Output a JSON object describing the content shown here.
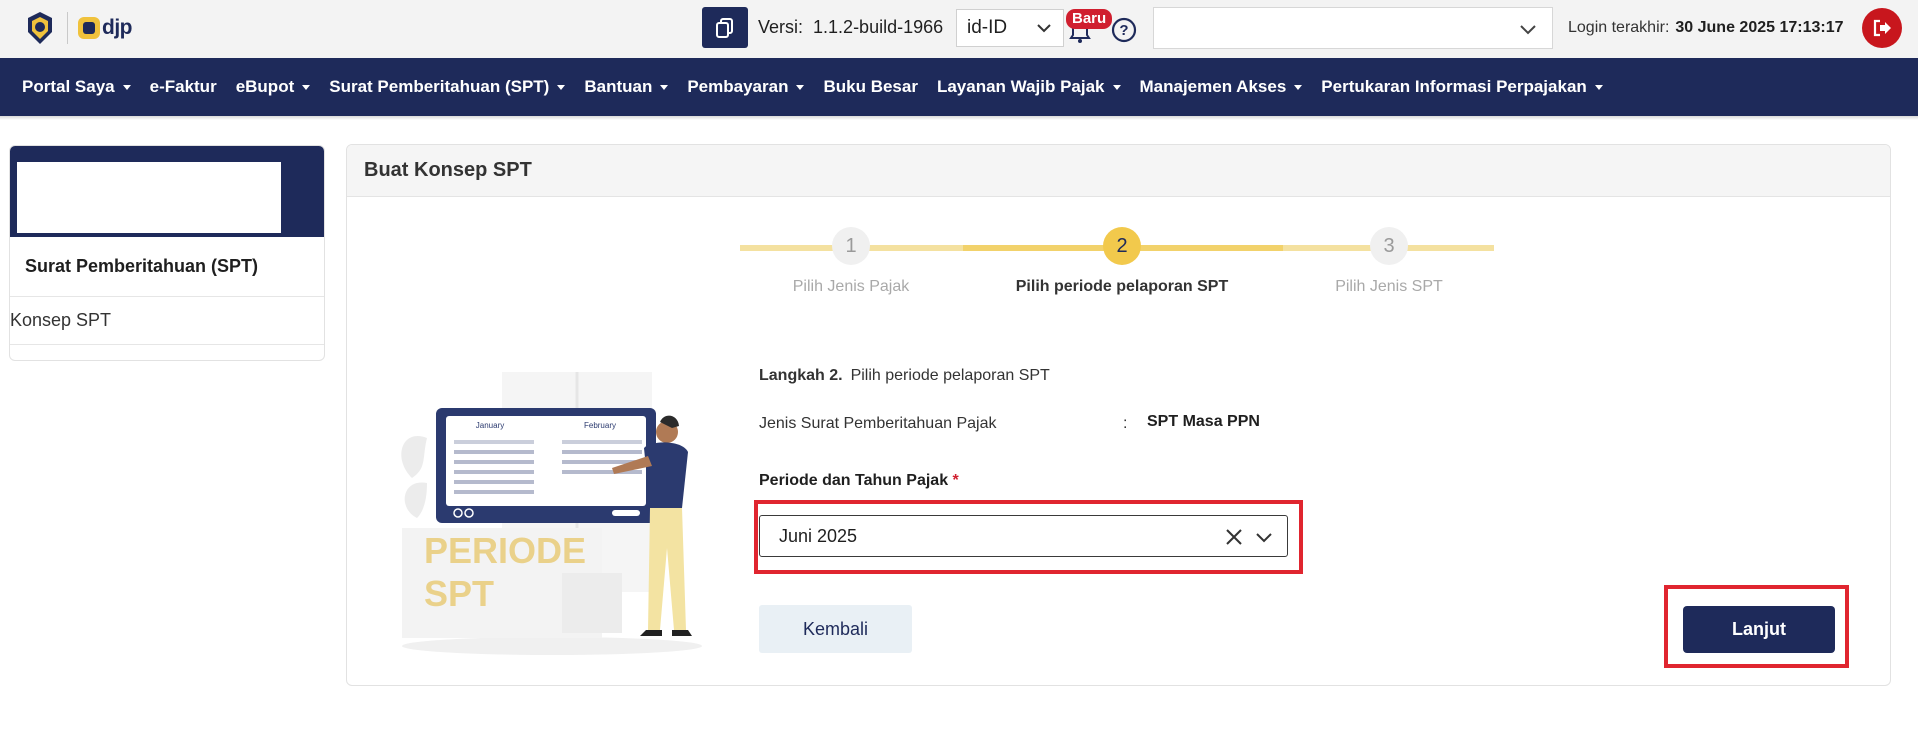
{
  "header": {
    "logo_text": "djp",
    "version_label": "Versi:",
    "version_value": "1.1.2-build-1966",
    "language": "id-ID",
    "notification_badge": "Baru",
    "login_label": "Login terakhir:",
    "login_value": "30 June 2025 17:13:17"
  },
  "nav": {
    "items": [
      {
        "label": "Portal Saya",
        "dropdown": true
      },
      {
        "label": "e-Faktur",
        "dropdown": false
      },
      {
        "label": "eBupot",
        "dropdown": true
      },
      {
        "label": "Surat Pemberitahuan (SPT)",
        "dropdown": true
      },
      {
        "label": "Bantuan",
        "dropdown": true
      },
      {
        "label": "Pembayaran",
        "dropdown": true
      },
      {
        "label": "Buku Besar",
        "dropdown": false
      },
      {
        "label": "Layanan Wajib Pajak",
        "dropdown": true
      },
      {
        "label": "Manajemen Akses",
        "dropdown": true
      },
      {
        "label": "Pertukaran Informasi Perpajakan",
        "dropdown": true
      }
    ]
  },
  "sidebar": {
    "title": "Surat Pemberitahuan (SPT)",
    "items": [
      {
        "label": "Konsep SPT"
      }
    ]
  },
  "card": {
    "title": "Buat Konsep SPT"
  },
  "stepper": {
    "current": 2,
    "steps": [
      {
        "number": "1",
        "label": "Pilih Jenis Pajak"
      },
      {
        "number": "2",
        "label": "Pilih periode pelaporan SPT"
      },
      {
        "number": "3",
        "label": "Pilih Jenis SPT"
      }
    ]
  },
  "illustration": {
    "title_line1": "PERIODE",
    "title_line2": "SPT",
    "month1": "January",
    "month2": "February"
  },
  "form": {
    "step_prefix": "Langkah 2.",
    "step_text": "Pilih periode pelaporan SPT",
    "jenis_label": "Jenis Surat Pemberitahuan Pajak",
    "jenis_colon": ":",
    "jenis_value": "SPT Masa PPN",
    "periode_label": "Periode dan Tahun Pajak",
    "periode_required": "*",
    "periode_value": "Juni 2025"
  },
  "buttons": {
    "back": "Kembali",
    "next": "Lanjut"
  },
  "colors": {
    "navy": "#1e2a5a",
    "accent_yellow": "#f2c94c",
    "highlight_red": "#e0252f",
    "logout_red": "#c8161d"
  }
}
